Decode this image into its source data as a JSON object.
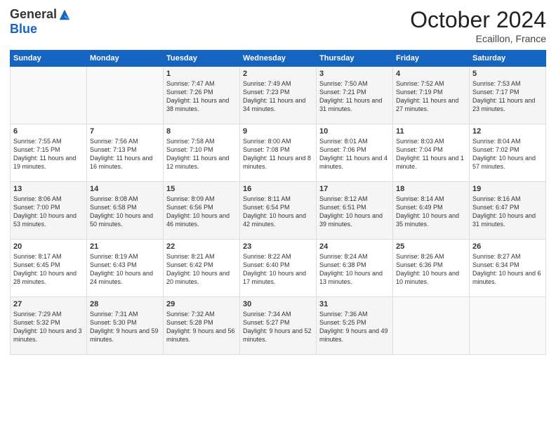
{
  "header": {
    "logo_general": "General",
    "logo_blue": "Blue",
    "month_title": "October 2024",
    "location": "Ecaillon, France"
  },
  "days_of_week": [
    "Sunday",
    "Monday",
    "Tuesday",
    "Wednesday",
    "Thursday",
    "Friday",
    "Saturday"
  ],
  "weeks": [
    [
      {
        "day": "",
        "detail": ""
      },
      {
        "day": "",
        "detail": ""
      },
      {
        "day": "1",
        "detail": "Sunrise: 7:47 AM\nSunset: 7:26 PM\nDaylight: 11 hours and 38 minutes."
      },
      {
        "day": "2",
        "detail": "Sunrise: 7:49 AM\nSunset: 7:23 PM\nDaylight: 11 hours and 34 minutes."
      },
      {
        "day": "3",
        "detail": "Sunrise: 7:50 AM\nSunset: 7:21 PM\nDaylight: 11 hours and 31 minutes."
      },
      {
        "day": "4",
        "detail": "Sunrise: 7:52 AM\nSunset: 7:19 PM\nDaylight: 11 hours and 27 minutes."
      },
      {
        "day": "5",
        "detail": "Sunrise: 7:53 AM\nSunset: 7:17 PM\nDaylight: 11 hours and 23 minutes."
      }
    ],
    [
      {
        "day": "6",
        "detail": "Sunrise: 7:55 AM\nSunset: 7:15 PM\nDaylight: 11 hours and 19 minutes."
      },
      {
        "day": "7",
        "detail": "Sunrise: 7:56 AM\nSunset: 7:13 PM\nDaylight: 11 hours and 16 minutes."
      },
      {
        "day": "8",
        "detail": "Sunrise: 7:58 AM\nSunset: 7:10 PM\nDaylight: 11 hours and 12 minutes."
      },
      {
        "day": "9",
        "detail": "Sunrise: 8:00 AM\nSunset: 7:08 PM\nDaylight: 11 hours and 8 minutes."
      },
      {
        "day": "10",
        "detail": "Sunrise: 8:01 AM\nSunset: 7:06 PM\nDaylight: 11 hours and 4 minutes."
      },
      {
        "day": "11",
        "detail": "Sunrise: 8:03 AM\nSunset: 7:04 PM\nDaylight: 11 hours and 1 minute."
      },
      {
        "day": "12",
        "detail": "Sunrise: 8:04 AM\nSunset: 7:02 PM\nDaylight: 10 hours and 57 minutes."
      }
    ],
    [
      {
        "day": "13",
        "detail": "Sunrise: 8:06 AM\nSunset: 7:00 PM\nDaylight: 10 hours and 53 minutes."
      },
      {
        "day": "14",
        "detail": "Sunrise: 8:08 AM\nSunset: 6:58 PM\nDaylight: 10 hours and 50 minutes."
      },
      {
        "day": "15",
        "detail": "Sunrise: 8:09 AM\nSunset: 6:56 PM\nDaylight: 10 hours and 46 minutes."
      },
      {
        "day": "16",
        "detail": "Sunrise: 8:11 AM\nSunset: 6:54 PM\nDaylight: 10 hours and 42 minutes."
      },
      {
        "day": "17",
        "detail": "Sunrise: 8:12 AM\nSunset: 6:51 PM\nDaylight: 10 hours and 39 minutes."
      },
      {
        "day": "18",
        "detail": "Sunrise: 8:14 AM\nSunset: 6:49 PM\nDaylight: 10 hours and 35 minutes."
      },
      {
        "day": "19",
        "detail": "Sunrise: 8:16 AM\nSunset: 6:47 PM\nDaylight: 10 hours and 31 minutes."
      }
    ],
    [
      {
        "day": "20",
        "detail": "Sunrise: 8:17 AM\nSunset: 6:45 PM\nDaylight: 10 hours and 28 minutes."
      },
      {
        "day": "21",
        "detail": "Sunrise: 8:19 AM\nSunset: 6:43 PM\nDaylight: 10 hours and 24 minutes."
      },
      {
        "day": "22",
        "detail": "Sunrise: 8:21 AM\nSunset: 6:42 PM\nDaylight: 10 hours and 20 minutes."
      },
      {
        "day": "23",
        "detail": "Sunrise: 8:22 AM\nSunset: 6:40 PM\nDaylight: 10 hours and 17 minutes."
      },
      {
        "day": "24",
        "detail": "Sunrise: 8:24 AM\nSunset: 6:38 PM\nDaylight: 10 hours and 13 minutes."
      },
      {
        "day": "25",
        "detail": "Sunrise: 8:26 AM\nSunset: 6:36 PM\nDaylight: 10 hours and 10 minutes."
      },
      {
        "day": "26",
        "detail": "Sunrise: 8:27 AM\nSunset: 6:34 PM\nDaylight: 10 hours and 6 minutes."
      }
    ],
    [
      {
        "day": "27",
        "detail": "Sunrise: 7:29 AM\nSunset: 5:32 PM\nDaylight: 10 hours and 3 minutes."
      },
      {
        "day": "28",
        "detail": "Sunrise: 7:31 AM\nSunset: 5:30 PM\nDaylight: 9 hours and 59 minutes."
      },
      {
        "day": "29",
        "detail": "Sunrise: 7:32 AM\nSunset: 5:28 PM\nDaylight: 9 hours and 56 minutes."
      },
      {
        "day": "30",
        "detail": "Sunrise: 7:34 AM\nSunset: 5:27 PM\nDaylight: 9 hours and 52 minutes."
      },
      {
        "day": "31",
        "detail": "Sunrise: 7:36 AM\nSunset: 5:25 PM\nDaylight: 9 hours and 49 minutes."
      },
      {
        "day": "",
        "detail": ""
      },
      {
        "day": "",
        "detail": ""
      }
    ]
  ]
}
